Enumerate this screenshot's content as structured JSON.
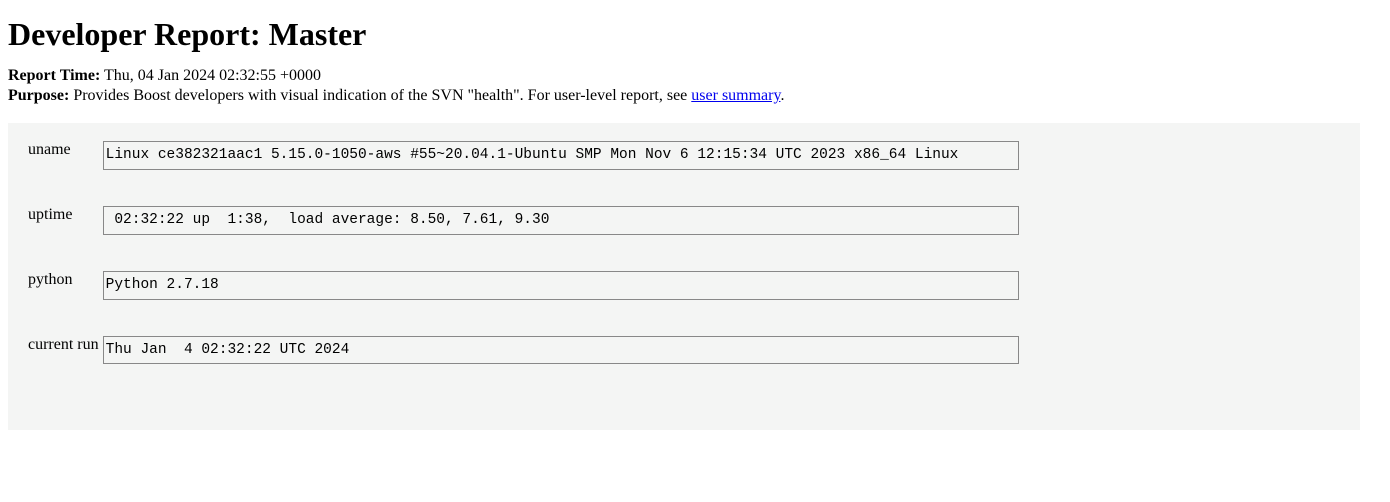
{
  "title": "Developer Report: Master",
  "meta": {
    "report_time_label": "Report Time:",
    "report_time_value": "Thu, 04 Jan 2024 02:32:55 +0000",
    "purpose_label": "Purpose:",
    "purpose_text_pre": "Provides Boost developers with visual indication of the SVN \"health\". For user-level report, see ",
    "purpose_link_text": "user summary",
    "purpose_text_post": "."
  },
  "rows": {
    "uname": {
      "label": "uname",
      "value": "Linux ce382321aac1 5.15.0-1050-aws #55~20.04.1-Ubuntu SMP Mon Nov 6 12:15:34 UTC 2023 x86_64 Linux"
    },
    "uptime": {
      "label": "uptime",
      "value": " 02:32:22 up  1:38,  load average: 8.50, 7.61, 9.30"
    },
    "python": {
      "label": "python",
      "value": "Python 2.7.18"
    },
    "current_run": {
      "label": "current run",
      "value": "Thu Jan  4 02:32:22 UTC 2024"
    }
  }
}
